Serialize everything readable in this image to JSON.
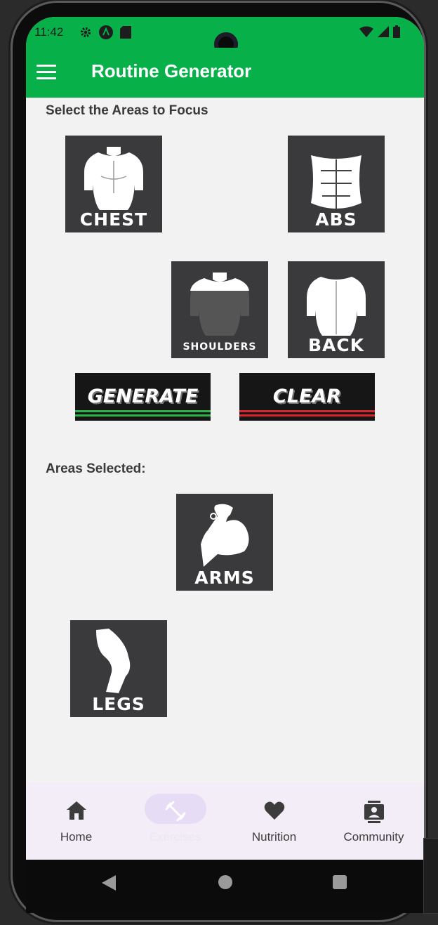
{
  "status_bar": {
    "time": "11:42"
  },
  "app_bar": {
    "title": "Routine Generator"
  },
  "focus_section": {
    "label": "Select the Areas to Focus"
  },
  "focus_areas": [
    {
      "label": "CHEST"
    },
    {
      "label": "ABS"
    },
    {
      "label": "SHOULDERS"
    },
    {
      "label": "BACK"
    }
  ],
  "actions": {
    "generate_label": "GENERATE",
    "clear_label": "CLEAR"
  },
  "selected_section": {
    "label": "Areas Selected:"
  },
  "selected_areas": [
    {
      "label": "ARMS"
    },
    {
      "label": "LEGS"
    }
  ],
  "bottom_nav": {
    "items": [
      {
        "label": "Home",
        "icon": "home-icon"
      },
      {
        "label": "Exercises",
        "icon": "dumbbell-icon",
        "active": true
      },
      {
        "label": "Nutrition",
        "icon": "heart-icon"
      },
      {
        "label": "Community",
        "icon": "contact-icon"
      }
    ]
  },
  "colors": {
    "primary": "#08b04a",
    "tile": "#3a3a3c",
    "generate_stripe": "#2db34a",
    "clear_stripe": "#d8262e",
    "nav_bg": "#f2edf6"
  }
}
